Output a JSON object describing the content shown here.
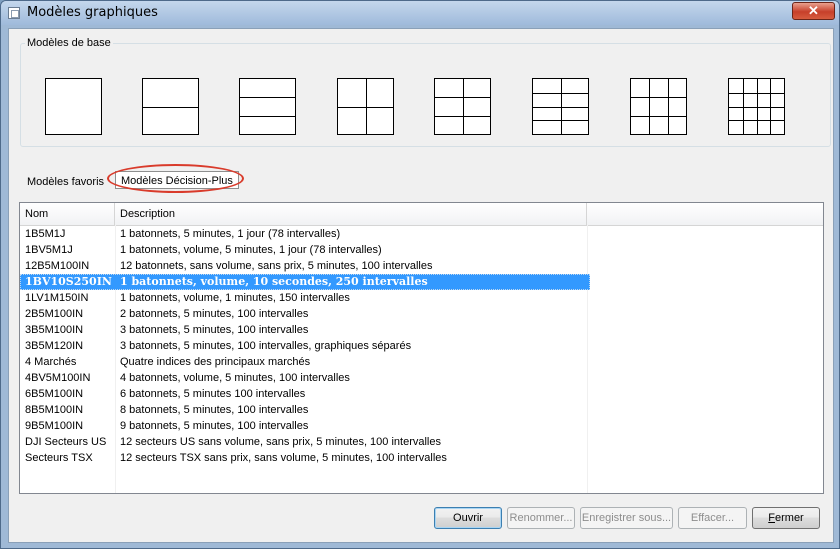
{
  "window": {
    "title": "Modèles graphiques",
    "close_label": "✕"
  },
  "base_templates": {
    "legend": "Modèles de base",
    "items": [
      {
        "name": "1 panneau",
        "rows": 1,
        "cols": 1
      },
      {
        "name": "2 panneaux horizontaux",
        "rows": 2,
        "cols": 1
      },
      {
        "name": "3 panneaux horizontaux",
        "rows": 3,
        "cols": 1
      },
      {
        "name": "2x2",
        "rows": 2,
        "cols": 2
      },
      {
        "name": "3x2",
        "rows": 3,
        "cols": 2
      },
      {
        "name": "4x2",
        "rows": 4,
        "cols": 2
      },
      {
        "name": "3x3",
        "rows": 3,
        "cols": 3
      },
      {
        "name": "4x4",
        "rows": 4,
        "cols": 4
      }
    ]
  },
  "favorites": {
    "label": "Modèles favoris",
    "tab_label": "Modèles Décision-Plus"
  },
  "table": {
    "columns": [
      "Nom",
      "Description"
    ],
    "selected_index": 3,
    "rows": [
      {
        "nom": "1B5M1J",
        "description": "1 batonnets, 5 minutes, 1 jour (78 intervalles)"
      },
      {
        "nom": "1BV5M1J",
        "description": "1 batonnets, volume, 5 minutes, 1 jour (78 intervalles)"
      },
      {
        "nom": "12B5M100IN",
        "description": "12 batonnets, sans volume, sans prix, 5 minutes, 100 intervalles"
      },
      {
        "nom": "1BV10S250IN",
        "description": "1 batonnets, volume, 10 secondes, 250 intervalles"
      },
      {
        "nom": "1LV1M150IN",
        "description": "1 batonnets, volume, 1 minutes, 150 intervalles"
      },
      {
        "nom": "2B5M100IN",
        "description": "2 batonnets, 5 minutes, 100 intervalles"
      },
      {
        "nom": "3B5M100IN",
        "description": "3 batonnets, 5 minutes, 100 intervalles"
      },
      {
        "nom": "3B5M120IN",
        "description": "3 batonnets, 5 minutes, 100 intervalles, graphiques séparés"
      },
      {
        "nom": "4 Marchés",
        "description": "Quatre indices des principaux marchés"
      },
      {
        "nom": "4BV5M100IN",
        "description": "4 batonnets,  volume, 5 minutes, 100 intervalles"
      },
      {
        "nom": "6B5M100IN",
        "description": "6 batonnets, 5 minutes 100 intervalles"
      },
      {
        "nom": "8B5M100IN",
        "description": "8 batonnets, 5 minutes, 100 intervalles"
      },
      {
        "nom": "9B5M100IN",
        "description": "9 batonnets, 5 minutes, 100 intervalles"
      },
      {
        "nom": "DJI Secteurs US",
        "description": "12 secteurs US sans volume, sans prix, 5 minutes, 100 intervalles"
      },
      {
        "nom": "Secteurs TSX",
        "description": "12 secteurs TSX sans prix, sans volume,  5 minutes, 100 intervalles"
      }
    ]
  },
  "buttons": {
    "open": "Ouvrir",
    "rename": "Renommer...",
    "save_as": "Enregistrer sous...",
    "delete": "Effacer...",
    "close_accel": "F",
    "close_rest": "ermer"
  },
  "colors": {
    "selection": "#3399ff",
    "highlight_ring": "#d93b2b"
  }
}
